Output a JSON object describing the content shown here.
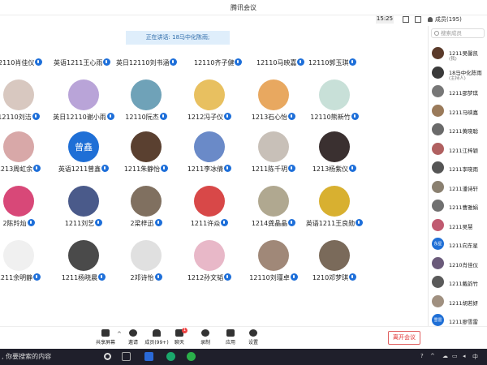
{
  "app": {
    "title": "腾讯会议",
    "time": "15:25"
  },
  "members_panel": {
    "header": "成员(195)",
    "search_placeholder": "搜索成员",
    "items": [
      {
        "name": "1211吴馨凯",
        "sub": "(我)",
        "color": "#5a3a2a"
      },
      {
        "name": "18马中化陈雨",
        "sub": "(主持人)",
        "color": "#3a3a3a"
      },
      {
        "name": "1211邵梦琪",
        "sub": "",
        "color": "#777"
      },
      {
        "name": "1211马映嘉",
        "sub": "",
        "color": "#9a7a5a"
      },
      {
        "name": "1211黄晓聪",
        "sub": "",
        "color": "#6a6a6a"
      },
      {
        "name": "1211江梓颖",
        "sub": "",
        "color": "#b06060"
      },
      {
        "name": "1211李晓雨",
        "sub": "",
        "color": "#555"
      },
      {
        "name": "1211潘诗轩",
        "sub": "",
        "color": "#8a8070"
      },
      {
        "name": "1211曹雅娟",
        "sub": "",
        "color": "#707070"
      },
      {
        "name": "1211吴慧",
        "sub": "",
        "color": "#c05a70"
      },
      {
        "name": "1211向东星",
        "sub": "",
        "color": "#1f6fd6",
        "initial": "东星"
      },
      {
        "name": "1210肖佳仪",
        "sub": "",
        "color": "#6a5a7a"
      },
      {
        "name": "1211戴韵竹",
        "sub": "",
        "color": "#5a5a5a"
      },
      {
        "name": "1211胡若妍",
        "sub": "",
        "color": "#a09080"
      },
      {
        "name": "1211廖雪雷",
        "sub": "",
        "color": "#1f6fd6",
        "initial": "雪雷"
      }
    ]
  },
  "grid": {
    "speaker_banner": "正在讲话: 18马中化陈雨;",
    "top_row": [
      "2110肖佳仪",
      "英语1211王心雨",
      "英日12110刘书涵",
      "12110齐子健",
      "12110马映嘉",
      "12110郭玉琪"
    ],
    "rows": [
      [
        {
          "name": "12110刘洁",
          "color": "#d8c8c0"
        },
        {
          "name": "英日12110谢小雨",
          "color": "#b9a4d8"
        },
        {
          "name": "12110阮杰",
          "color": "#6fa2b8"
        },
        {
          "name": "1212冯子仪",
          "color": "#e8c060"
        },
        {
          "name": "1213石心怡",
          "color": "#e8a860"
        },
        {
          "name": "12110熊新竹",
          "color": "#c8e0d8"
        }
      ],
      [
        {
          "name": "1213周虹余",
          "color": "#d8a8a8"
        },
        {
          "name": "英语1211曾鑫",
          "color": "#1f6fd6",
          "initial": "曾鑫"
        },
        {
          "name": "1211朱静怡",
          "color": "#5a4030"
        },
        {
          "name": "1211李冰倩",
          "color": "#6a8ac8"
        },
        {
          "name": "1211陈千玥",
          "color": "#c8c0b8"
        },
        {
          "name": "1213杨紫仪",
          "color": "#3a3030"
        }
      ],
      [
        {
          "name": "2陈羚灿",
          "color": "#d84878"
        },
        {
          "name": "1211刘艺",
          "color": "#4a5a8a"
        },
        {
          "name": "2梁梓迅",
          "color": "#807060"
        },
        {
          "name": "1211许焱",
          "color": "#d84848"
        },
        {
          "name": "1214龚晶晶",
          "color": "#b0a890"
        },
        {
          "name": "英语1211王良勋",
          "color": "#d8b030"
        }
      ],
      [
        {
          "name": "1211余明静",
          "color": "#f0f0f0"
        },
        {
          "name": "1211杨晓晨",
          "color": "#4a4a4a"
        },
        {
          "name": "2邓诗怡",
          "color": "#e0e0e0"
        },
        {
          "name": "1212孙文韬",
          "color": "#e8b8c8"
        },
        {
          "name": "12110刘瑾卓",
          "color": "#a08878"
        },
        {
          "name": "1210邓梦琪",
          "color": "#7a6a5a"
        }
      ]
    ]
  },
  "toolbar": {
    "share": "共享屏幕",
    "invite": "邀请",
    "members": "成员(99+)",
    "chat": "聊天",
    "chat_badge": "1",
    "record": "录制",
    "apps": "应用",
    "settings": "设置",
    "leave": "离开会议"
  },
  "taskbar": {
    "search_text": ", 你要搜索的内容"
  },
  "colors": {
    "accent": "#1e6fd9",
    "leave": "#e03030",
    "banner": "#dfeefb",
    "taskbar": "#1f1f2b"
  }
}
